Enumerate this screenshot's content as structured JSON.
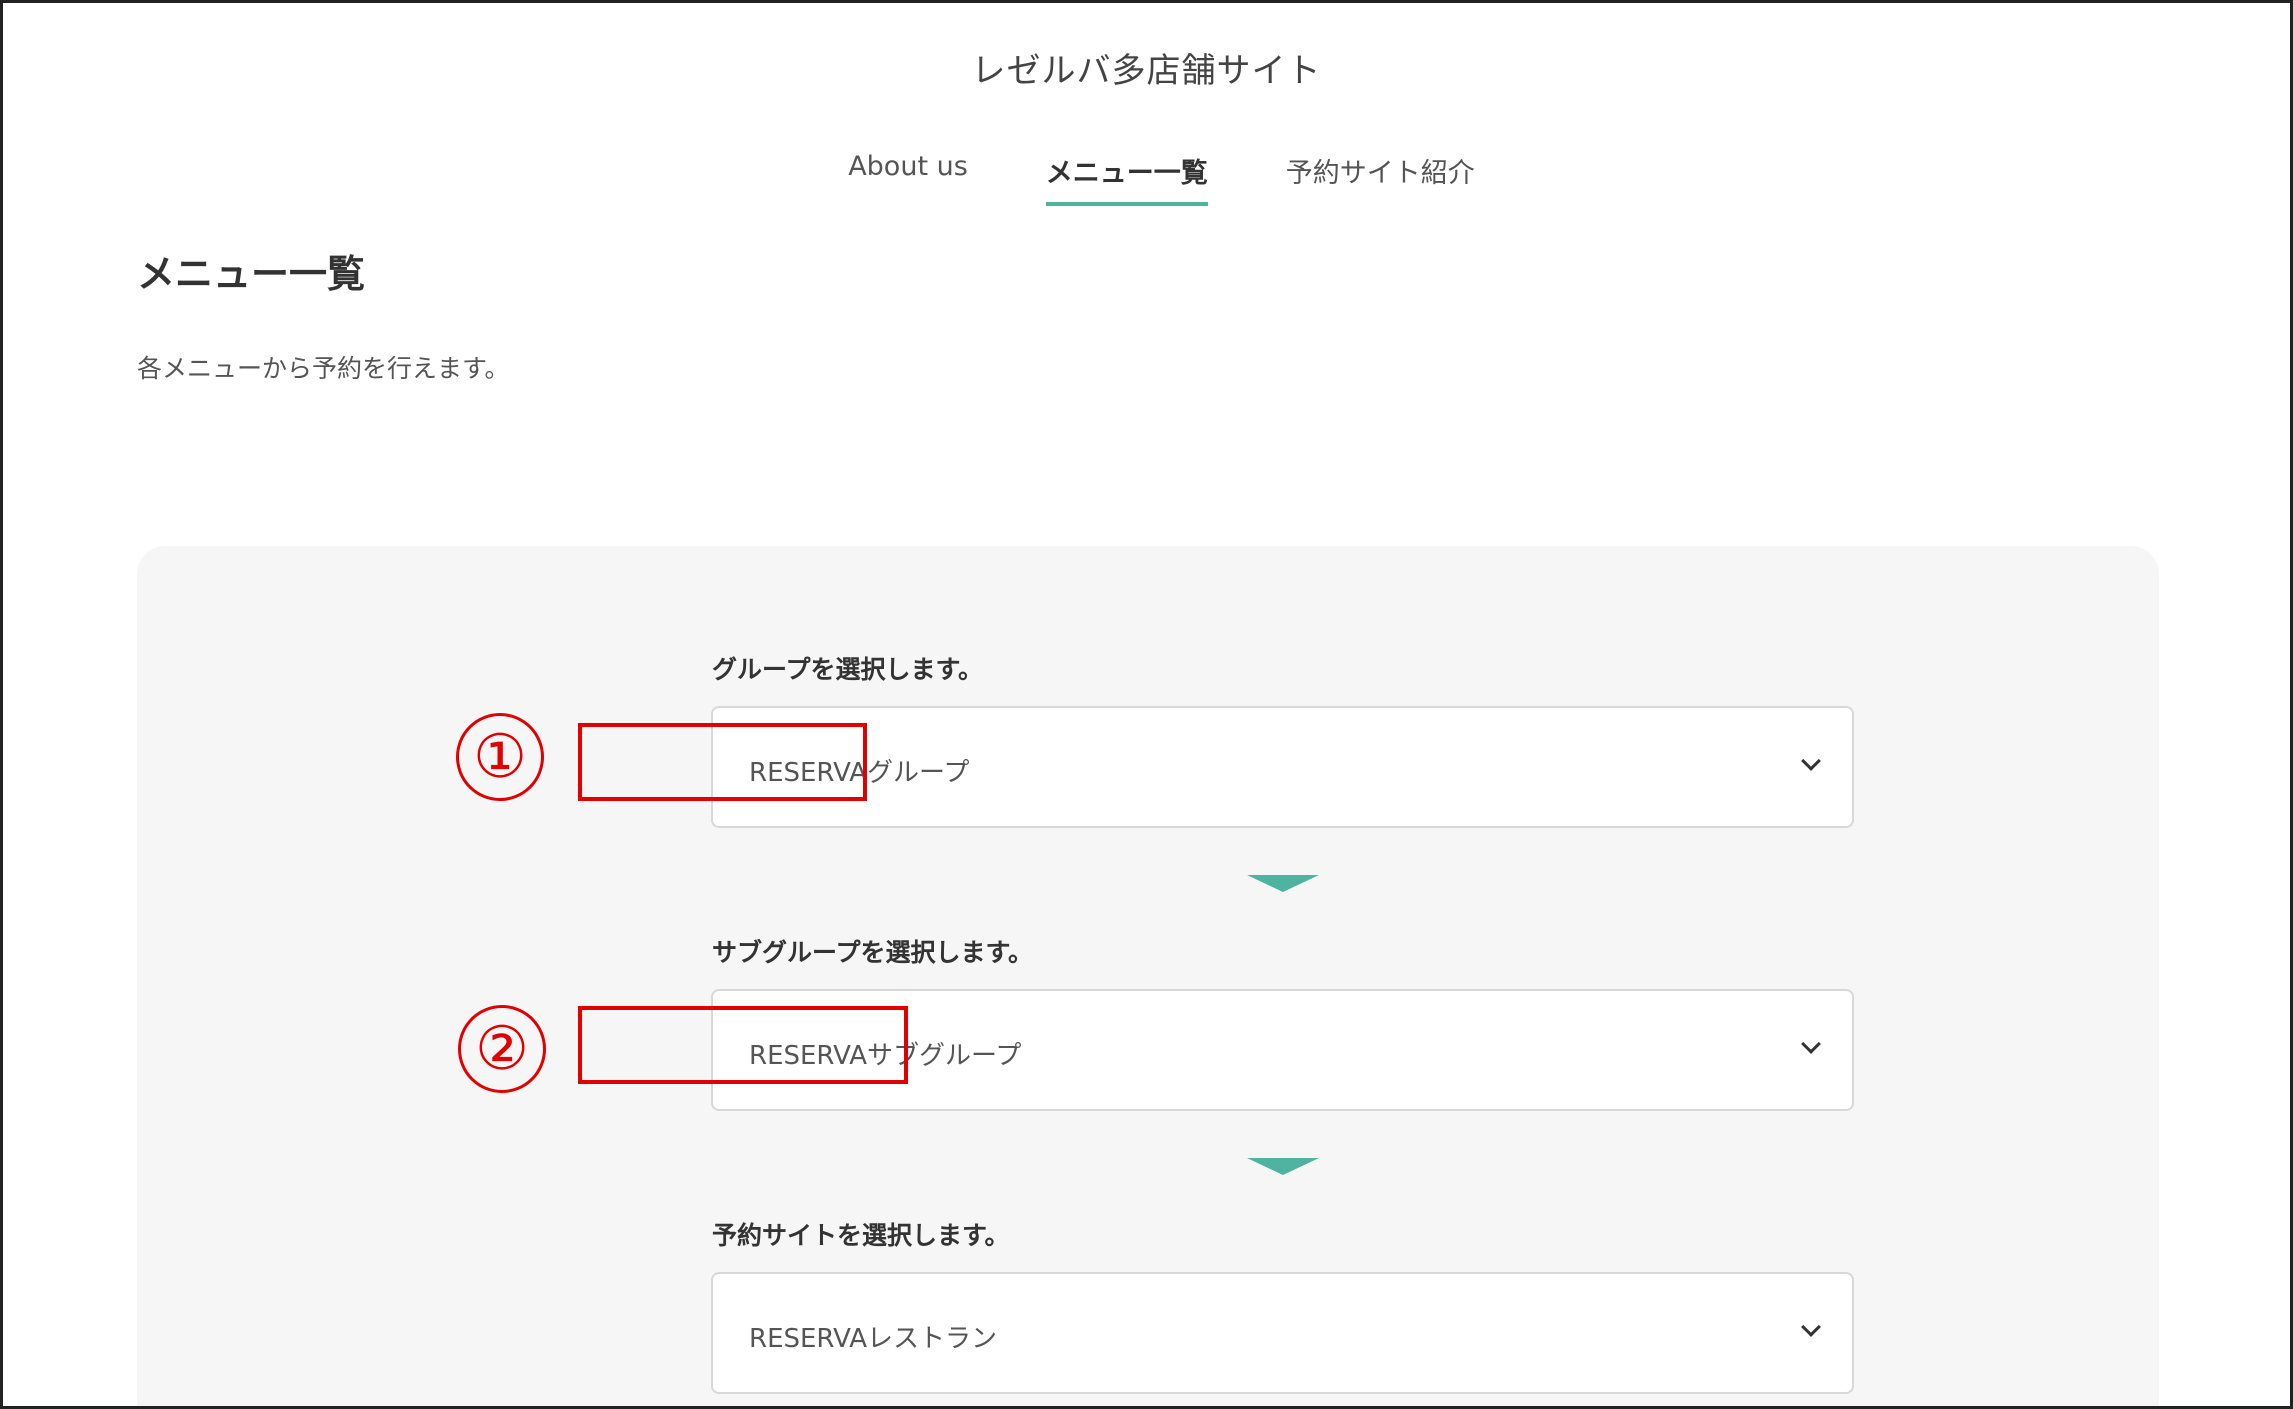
{
  "header": {
    "site_title": "レゼルバ多店舗サイト"
  },
  "nav": {
    "items": [
      {
        "label": "About us",
        "active": false
      },
      {
        "label": "メニュー一覧",
        "active": true
      },
      {
        "label": "予約サイト紹介",
        "active": false
      }
    ]
  },
  "main": {
    "title": "メニュー一覧",
    "description": "各メニューから予約を行えます。"
  },
  "steps": [
    {
      "label": "グループを選択します。",
      "selected": "RESERVAグループ"
    },
    {
      "label": "サブグループを選択します。",
      "selected": "RESERVAサブグループ"
    },
    {
      "label": "予約サイトを選択します。",
      "selected": "RESERVAレストラン"
    }
  ],
  "annotations": {
    "one": "①",
    "two": "②"
  },
  "colors": {
    "accent": "#4fb3a1",
    "annotation": "#e00000",
    "panel_bg": "#f6f6f6"
  }
}
